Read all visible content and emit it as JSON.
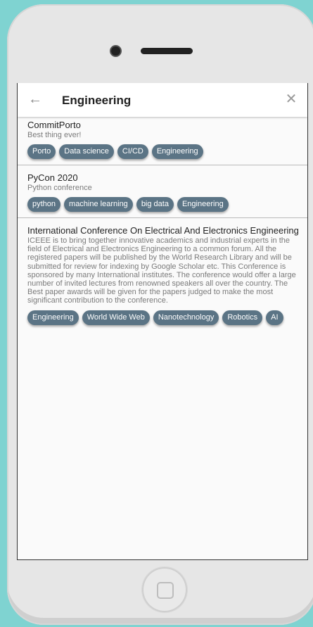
{
  "header": {
    "title": "Engineering"
  },
  "icons": {
    "back": "arrow-left-icon",
    "close": "close-icon"
  },
  "colors": {
    "chip": "#5b7485",
    "background": "#7fd3d1"
  },
  "events": [
    {
      "title": "CommitPorto",
      "subtitle": "Best thing ever!",
      "tags": [
        "Porto",
        "Data science",
        "CI/CD",
        "Engineering"
      ]
    },
    {
      "title": "PyCon 2020",
      "subtitle": "Python conference",
      "tags": [
        "python",
        "machine learning",
        "big data",
        "Engineering"
      ]
    },
    {
      "title": "International Conference On Electrical And Electronics Engineering",
      "subtitle": "ICEEE is to bring together innovative academics and industrial experts in the field of Electrical and Electronics Engineering to a common forum. All the registered papers will be published by the World Research Library and will be submitted for review for indexing by Google Scholar etc. This Conference is sponsored by many International institutes. The conference would offer a large number of invited lectures from renowned speakers all over the country. The Best paper awards will be given for the papers judged to make the most significant contribution to the conference.",
      "tags": [
        "Engineering",
        "World Wide Web",
        "Nanotechnology",
        "Robotics",
        "AI"
      ]
    }
  ]
}
